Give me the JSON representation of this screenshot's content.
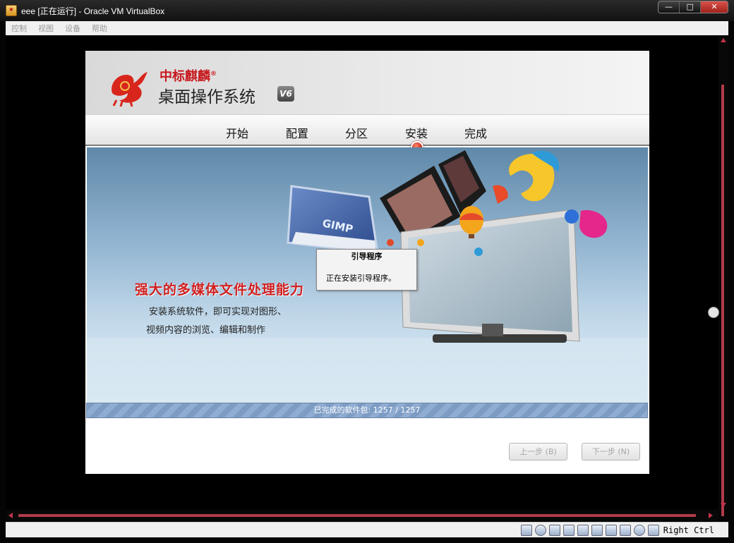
{
  "window": {
    "title": "eee [正在运行] - Oracle VM VirtualBox",
    "buttons": {
      "minimize": "—",
      "maximize": "□",
      "close": "✕"
    }
  },
  "menubar": {
    "items": [
      "控制",
      "视图",
      "设备",
      "帮助"
    ]
  },
  "installer": {
    "brand": "中标麒麟",
    "brand_mark": "®",
    "product": "桌面操作系统",
    "version_badge": "V6",
    "steps": [
      "开始",
      "配置",
      "分区",
      "安装",
      "完成"
    ],
    "current_step": "安装",
    "banner": {
      "tagline": "强大的多媒体文件处理能力",
      "desc_line1": "安装系统软件，即可实现对图形、",
      "desc_line2": "视频内容的浏览、编辑和制作",
      "gimp_label": "GIMP"
    },
    "dialog": {
      "title": "引导程序",
      "message": "正在安装引导程序。"
    },
    "progress": {
      "text": "已完成的软件包: 1257 / 1257",
      "completed": 1257,
      "total": 1257
    },
    "back_button": "上一步 (B)",
    "next_button": "下一步 (N)"
  },
  "statusbar": {
    "host_key": "Right Ctrl"
  },
  "colors": {
    "accent_red": "#c8181c",
    "scroll_red": "#b23a4a",
    "progress_blue": "#7d9cc4"
  }
}
